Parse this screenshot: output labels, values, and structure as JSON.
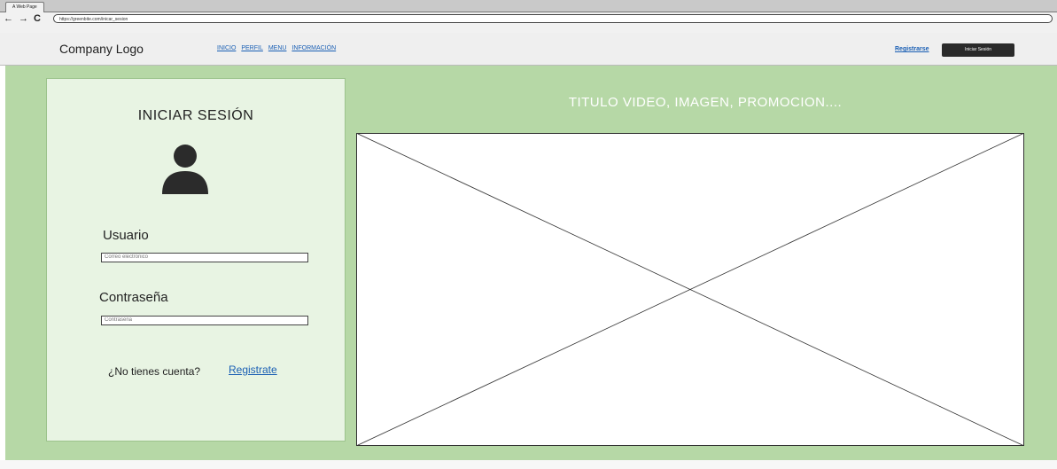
{
  "browser": {
    "tab_title": "A Web Page",
    "back": "←",
    "forward": "→",
    "reload": "C",
    "url": "https://greenbite.com/inicar_sesion"
  },
  "header": {
    "logo": "Company Logo",
    "nav": [
      "INICIO",
      "PERFIL",
      "MENU",
      "INFORMACIÓN"
    ],
    "register_link": "Registrarse",
    "login_button": "Iniciar Sesión"
  },
  "login": {
    "title": "INICIAR SESIÓN",
    "icon": "user-icon",
    "username_label": "Usuario",
    "username_placeholder": "Correo electrónico",
    "password_label": "Contraseña",
    "password_placeholder": "Contraseña",
    "no_account_text": "¿No tienes cuenta?",
    "signup_link": "Registrate"
  },
  "promo": {
    "title": "TITULO VIDEO, IMAGEN, PROMOCION...."
  },
  "colors": {
    "main_bg": "#b6d8a6",
    "panel_bg": "#e8f4e3",
    "link": "#1a5fb4",
    "button_bg": "#2a2a2a"
  }
}
